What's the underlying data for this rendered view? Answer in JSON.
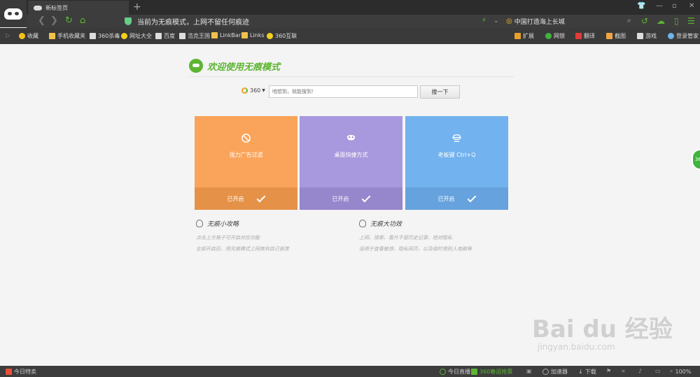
{
  "tab": {
    "title": "新标签页"
  },
  "toolbar": {
    "address_text": "当前为无痕模式，上网不留任何痕迹",
    "search_hint": "中国打造海上长城"
  },
  "bookmarks": {
    "left": [
      {
        "label": "收藏",
        "icon": "star-icon",
        "color": "#f3c21a"
      },
      {
        "label": "手机收藏夹",
        "icon": "folder-icon",
        "color": "#f0c24a"
      },
      {
        "label": "360杀毒",
        "icon": "page-icon",
        "color": "#dddddd"
      },
      {
        "label": "网址大全",
        "icon": "360-icon",
        "color": "#f2d01f"
      },
      {
        "label": "百度",
        "icon": "page-icon",
        "color": "#dddddd"
      },
      {
        "label": "浩克王国",
        "icon": "page-icon",
        "color": "#dddddd"
      },
      {
        "label": "LinkBar",
        "icon": "folder-icon",
        "color": "#f0c24a"
      },
      {
        "label": "Links",
        "icon": "folder-icon",
        "color": "#f0c24a"
      },
      {
        "label": "360互联",
        "icon": "360-icon",
        "color": "#f2d01f"
      }
    ],
    "right": [
      {
        "label": "扩展",
        "icon": "grid-icon",
        "color": "#e8a12a"
      },
      {
        "label": "网银",
        "icon": "shield-icon",
        "color": "#41b33e"
      },
      {
        "label": "翻译",
        "icon": "translate-icon",
        "color": "#e23b3b"
      },
      {
        "label": "截图",
        "icon": "scissors-icon",
        "color": "#f0a545"
      },
      {
        "label": "游戏",
        "icon": "gamepad-icon",
        "color": "#dddddd"
      },
      {
        "label": "登录管家",
        "icon": "key-icon",
        "color": "#6fb3e8"
      }
    ]
  },
  "main": {
    "welcome": "欢迎使用无痕模式",
    "engine_label": "360",
    "search_placeholder": "咱想到，就能搜到！",
    "search_button": "搜一下",
    "cards": [
      {
        "title": "强力广告过滤",
        "status": "已开启",
        "color": "#f9a45a",
        "foot_color": "#e59248",
        "icon": "ban-icon"
      },
      {
        "title": "桌面快捷方式",
        "status": "已开启",
        "color": "#a898dd",
        "foot_color": "#9686cc",
        "icon": "mask-icon"
      },
      {
        "title": "老板键 Ctrl+Q",
        "status": "已开启",
        "color": "#72b2ee",
        "foot_color": "#66a2dd",
        "icon": "boss-icon"
      }
    ],
    "tips_left": {
      "title": "无痕小攻略",
      "lines": [
        "点击上方格子可开启对应功能",
        "全部开启后，用无痕模式上网爽到自己偷笑"
      ]
    },
    "tips_right": {
      "title": "无痕大功效",
      "lines": [
        "上网、搜索、看片不留历史记录，绝对隐私",
        "适用于查看敏感、隐私网页，以及临时用别人电脑等"
      ]
    },
    "side_badge": "36"
  },
  "watermark": {
    "main": "Bai du 经验",
    "sub": "jingyan.baidu.com"
  },
  "status": {
    "left": "今日特卖",
    "live": "今日直播",
    "promo": "360春运抢票",
    "accelerator": "加速器",
    "download": "下载",
    "zoom": "100%"
  },
  "colors": {
    "accent_green": "#5cb531",
    "chrome_dark": "#3d3d3d"
  }
}
